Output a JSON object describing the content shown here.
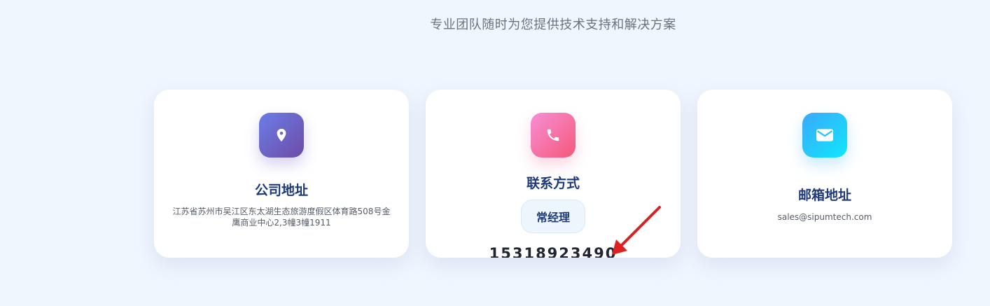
{
  "header": {
    "subtitle": "专业团队随时为您提供技术支持和解决方案"
  },
  "cards": [
    {
      "icon": "location-pin-icon",
      "title": "公司地址",
      "text": "江苏省苏州市吴江区东太湖生态旅游度假区体育路508号金鹰商业中心2,3幢3幢1911"
    },
    {
      "icon": "phone-icon",
      "title": "联系方式",
      "contact_name": "常经理",
      "phone": "15318923490"
    },
    {
      "icon": "mail-icon",
      "title": "邮箱地址",
      "text": "sales@sipumtech.com"
    }
  ],
  "colors": {
    "background": "#f0f6fe",
    "title": "#1f3a78",
    "arrow": "#e02020"
  }
}
